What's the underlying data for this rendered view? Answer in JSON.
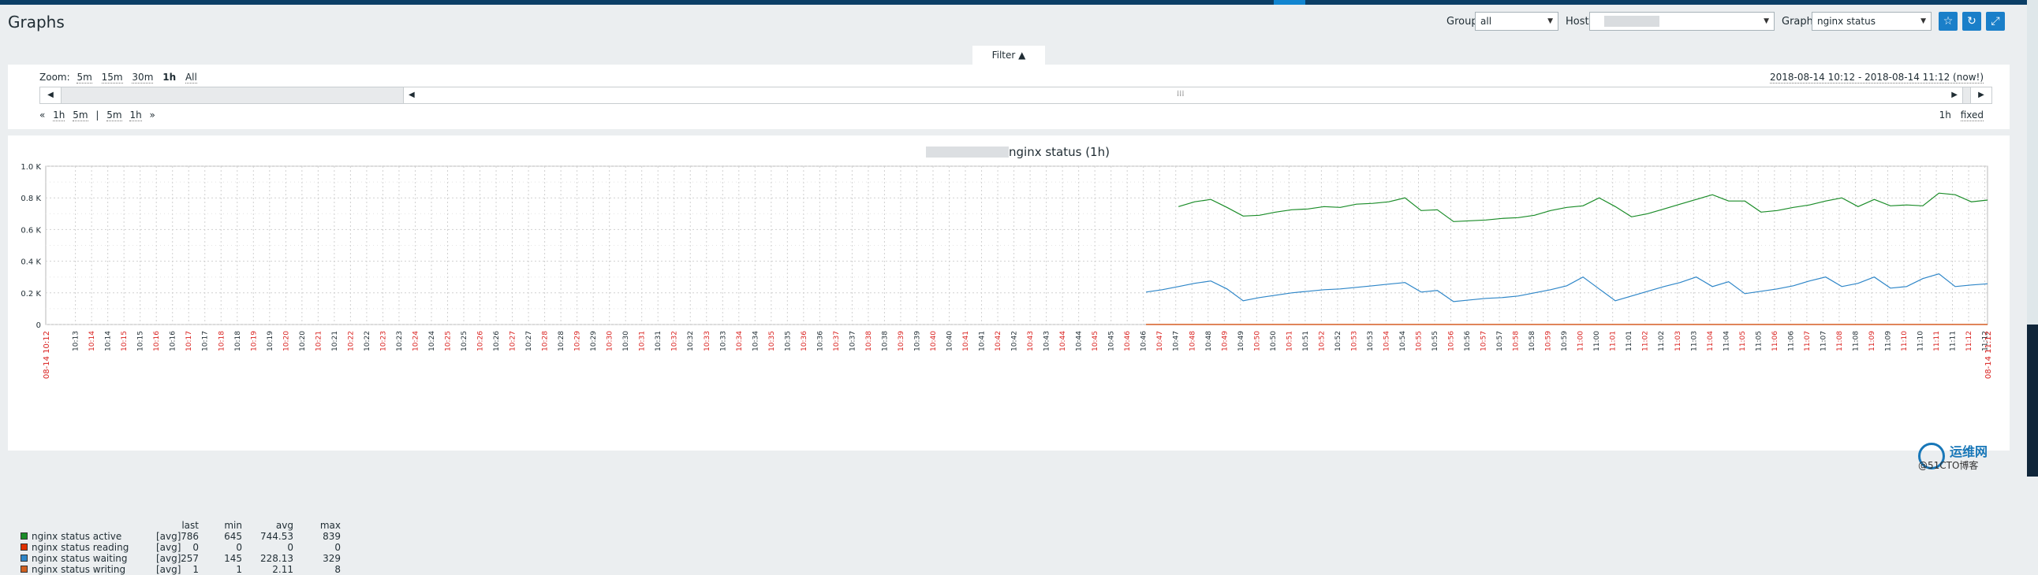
{
  "page": {
    "title": "Graphs"
  },
  "filters": {
    "group_label": "Group",
    "group_value": "all",
    "host_label": "Host",
    "graph_label": "Graph",
    "graph_value": "nginx status"
  },
  "icons": [
    "star-icon",
    "refresh-icon",
    "fullscreen-icon"
  ],
  "filter_tab": {
    "label": "Filter ▲"
  },
  "timeline": {
    "zoom_label": "Zoom:",
    "zoom_options": [
      "5m",
      "15m",
      "30m",
      "1h",
      "All"
    ],
    "zoom_current": "1h",
    "period": "2018-08-14 10:12 - 2018-08-14 11:12 (now!)",
    "nav_left": [
      "«",
      "1h",
      "5m",
      "|",
      "5m",
      "1h",
      "»"
    ],
    "nav_right": [
      "1h",
      "fixed"
    ]
  },
  "graph": {
    "title_suffix": "nginx status (1h)",
    "colors": {
      "active": "#1a8c28",
      "reading": "#e03000",
      "waiting": "#2e86c8",
      "writing": "#d06020",
      "red_label": "#d9201e",
      "grid": "#d0d0d0"
    }
  },
  "chart_data": {
    "type": "line",
    "ylim": [
      0,
      1000
    ],
    "y_ticks": [
      "0",
      "0.2 K",
      "0.4 K",
      "0.6 K",
      "0.8 K",
      "1.0 K"
    ],
    "x_start_label": "08-14 10:12",
    "x_end_label": "08-14 11:12",
    "x_tick_labels": [
      "10:13:30",
      "10:14:00",
      "10:14:30",
      "10:15:00",
      "10:15:30",
      "10:16:00",
      "10:16:30",
      "10:17:00",
      "10:17:30",
      "10:18:00",
      "10:18:30",
      "10:19:00",
      "10:19:30",
      "10:20:00",
      "10:20:30",
      "10:21:00",
      "10:21:30",
      "10:22:00",
      "10:22:30",
      "10:23:00",
      "10:23:30",
      "10:24:00",
      "10:24:30",
      "10:25:00",
      "10:25:30",
      "10:26:00",
      "10:26:30",
      "10:27:00",
      "10:27:30",
      "10:28:00",
      "10:28:30",
      "10:29:00",
      "10:29:30",
      "10:30:00",
      "10:30:30",
      "10:31:00",
      "10:31:30",
      "10:32:00",
      "10:32:30",
      "10:33:00",
      "10:33:30",
      "10:34:00",
      "10:34:30",
      "10:35:00",
      "10:35:30",
      "10:36:00",
      "10:36:30",
      "10:37:00",
      "10:37:30",
      "10:38:00",
      "10:38:30",
      "10:39:00",
      "10:39:30",
      "10:40:00",
      "10:40:30",
      "10:41:00",
      "10:41:30",
      "10:42:00",
      "10:42:30",
      "10:43:00",
      "10:43:30",
      "10:44:00",
      "10:44:30",
      "10:45:00",
      "10:45:30",
      "10:46:00",
      "10:46:30",
      "10:47:00",
      "10:47:30",
      "10:48:00",
      "10:48:30",
      "10:49:00",
      "10:49:30",
      "10:50:00",
      "10:50:30",
      "10:51:00",
      "10:51:30",
      "10:52:00",
      "10:52:30",
      "10:53:00",
      "10:53:30",
      "10:54:00",
      "10:54:30",
      "10:55:00",
      "10:55:30",
      "10:56:00",
      "10:56:30",
      "10:57:00",
      "10:57:30",
      "10:58:00",
      "10:58:30",
      "10:59:00",
      "10:59:30",
      "11:00:00",
      "11:00:30",
      "11:01:00",
      "11:01:30",
      "11:02:00",
      "11:02:30",
      "11:03:00",
      "11:03:30",
      "11:04:00",
      "11:04:30",
      "11:05:00",
      "11:05:30",
      "11:06:00",
      "11:06:30",
      "11:07:00",
      "11:07:30",
      "11:08:00",
      "11:08:30",
      "11:09:00",
      "11:09:30",
      "11:10:00",
      "11:10:30",
      "11:11:00",
      "11:11:30",
      "11:12:00",
      "11:12:30"
    ],
    "series": [
      {
        "name": "nginx status active",
        "func": "[avg]",
        "last": "786",
        "min": "645",
        "avg": "744.53",
        "max": "839",
        "color": "#1a8c28",
        "x": [
          "10:47:35",
          "10:48:05",
          "10:48:35",
          "10:49:05",
          "10:49:35",
          "10:50:05",
          "10:50:35",
          "10:51:05",
          "10:51:35",
          "10:52:05",
          "10:52:35",
          "10:53:05",
          "10:53:35",
          "10:54:05",
          "10:54:35",
          "10:55:05",
          "10:55:35",
          "10:56:05",
          "10:56:35",
          "10:57:05",
          "10:57:35",
          "10:58:05",
          "10:58:35",
          "10:59:05",
          "10:59:35",
          "11:00:05",
          "11:00:35",
          "11:01:05",
          "11:01:35",
          "11:02:05",
          "11:02:35",
          "11:03:05",
          "11:03:35",
          "11:04:05",
          "11:04:35",
          "11:05:05",
          "11:05:35",
          "11:06:05",
          "11:06:35",
          "11:07:05",
          "11:07:35",
          "11:08:05",
          "11:08:35",
          "11:09:05",
          "11:09:35",
          "11:10:05",
          "11:10:35",
          "11:11:05",
          "11:11:35",
          "11:12:05",
          "11:12:35"
        ],
        "values": [
          745,
          775,
          790,
          740,
          685,
          690,
          710,
          725,
          730,
          745,
          740,
          760,
          765,
          775,
          800,
          720,
          725,
          650,
          655,
          660,
          670,
          675,
          690,
          720,
          740,
          750,
          800,
          745,
          680,
          700,
          730,
          760,
          790,
          820,
          780,
          780,
          710,
          720,
          740,
          755,
          780,
          800,
          745,
          790,
          750,
          755,
          750,
          830,
          820,
          775,
          786
        ]
      },
      {
        "name": "nginx status reading",
        "func": "[avg]",
        "last": "0",
        "min": "0",
        "avg": "0",
        "max": "0",
        "color": "#e03000",
        "x": [
          "10:46:35",
          "11:12:35"
        ],
        "values": [
          0,
          0
        ]
      },
      {
        "name": "nginx status waiting",
        "func": "[avg]",
        "last": "257",
        "min": "145",
        "avg": "228.13",
        "max": "329",
        "color": "#2e86c8",
        "x": [
          "10:46:35",
          "10:47:05",
          "10:47:35",
          "10:48:05",
          "10:48:35",
          "10:49:05",
          "10:49:35",
          "10:50:05",
          "10:50:35",
          "10:51:05",
          "10:51:35",
          "10:52:05",
          "10:52:35",
          "10:53:05",
          "10:53:35",
          "10:54:05",
          "10:54:35",
          "10:55:05",
          "10:55:35",
          "10:56:05",
          "10:56:35",
          "10:57:05",
          "10:57:35",
          "10:58:05",
          "10:58:35",
          "10:59:05",
          "10:59:35",
          "11:00:05",
          "11:00:35",
          "11:01:05",
          "11:01:35",
          "11:02:05",
          "11:02:35",
          "11:03:05",
          "11:03:35",
          "11:04:05",
          "11:04:35",
          "11:05:05",
          "11:05:35",
          "11:06:05",
          "11:06:35",
          "11:07:05",
          "11:07:35",
          "11:08:05",
          "11:08:35",
          "11:09:05",
          "11:09:35",
          "11:10:05",
          "11:10:35",
          "11:11:05",
          "11:11:35",
          "11:12:05",
          "11:12:35"
        ],
        "values": [
          205,
          220,
          240,
          260,
          275,
          225,
          150,
          170,
          185,
          200,
          210,
          220,
          225,
          235,
          245,
          255,
          265,
          205,
          215,
          145,
          155,
          165,
          170,
          180,
          200,
          220,
          245,
          300,
          225,
          150,
          180,
          210,
          240,
          265,
          300,
          240,
          270,
          195,
          210,
          225,
          245,
          275,
          300,
          240,
          260,
          300,
          230,
          240,
          290,
          320,
          240,
          250,
          257
        ]
      },
      {
        "name": "nginx status writing",
        "func": "[avg]",
        "last": "1",
        "min": "1",
        "avg": "2.11",
        "max": "8",
        "color": "#d06020",
        "x": [
          "10:46:35",
          "11:12:35"
        ],
        "values": [
          1,
          1
        ]
      }
    ]
  },
  "legend_headers": {
    "last": "last",
    "min": "min",
    "avg": "avg",
    "max": "max"
  },
  "watermark": {
    "line1": "运维网",
    "line2": "@51CTO博客"
  }
}
